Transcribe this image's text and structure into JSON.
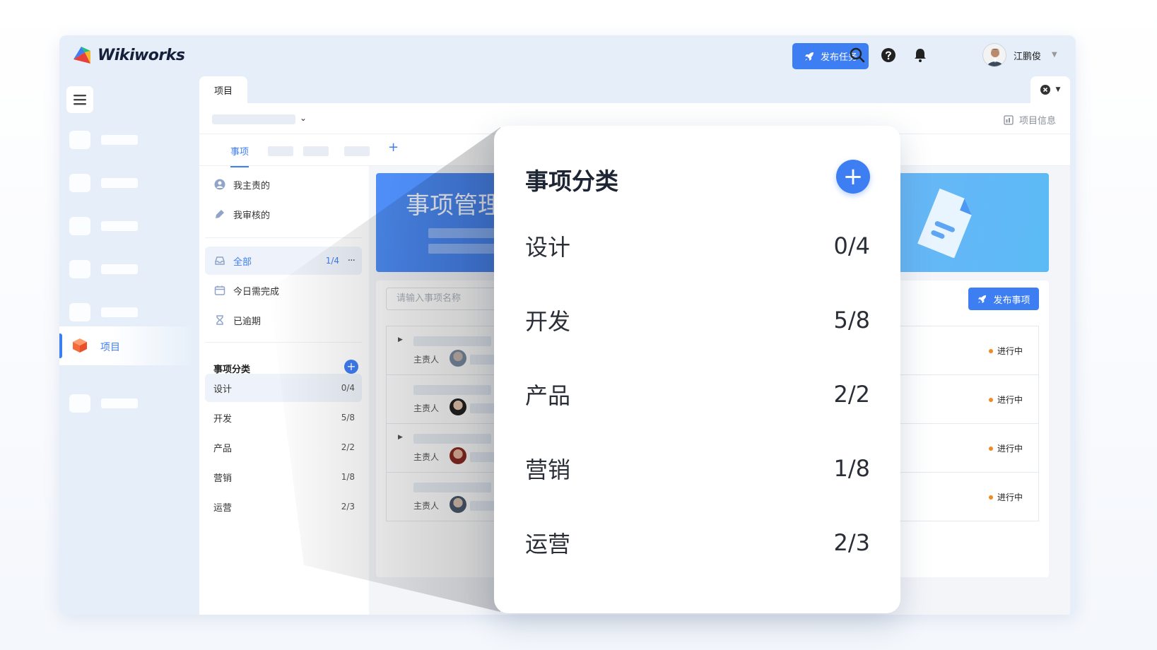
{
  "app": {
    "brand": "Wikiworks",
    "publish_task_label": "发布任务",
    "user_name": "江鹏俊"
  },
  "rail": {
    "active_label": "项目"
  },
  "tabs": {
    "project_tab": "项目"
  },
  "project": {
    "info_label": "项目信息"
  },
  "subtabs": {
    "active": "事项",
    "add": "+"
  },
  "left_nav": {
    "items": [
      {
        "label": "我主责的",
        "icon": "user-icon"
      },
      {
        "label": "我审核的",
        "icon": "pen-icon"
      }
    ],
    "filters": [
      {
        "label": "全部",
        "count": "1/4",
        "icon": "inbox-icon"
      },
      {
        "label": "今日需完成",
        "icon": "calendar-icon"
      },
      {
        "label": "已逾期",
        "icon": "hourglass-icon"
      }
    ],
    "category_title": "事项分类",
    "category_add": "+",
    "categories": [
      {
        "label": "设计",
        "count": "0/4"
      },
      {
        "label": "开发",
        "count": "5/8"
      },
      {
        "label": "产品",
        "count": "2/2"
      },
      {
        "label": "营销",
        "count": "1/8"
      },
      {
        "label": "运营",
        "count": "2/3"
      }
    ]
  },
  "content": {
    "banner_title": "事项管理",
    "search_placeholder": "请输入事项名称",
    "publish_item_label": "发布事项",
    "owner_label": "主责人",
    "rows": [
      {
        "status": "进行中",
        "expandable": true
      },
      {
        "status": "进行中",
        "expandable": false
      },
      {
        "status": "进行中",
        "expandable": true
      },
      {
        "status": "进行中",
        "expandable": false
      }
    ]
  },
  "popout": {
    "title": "事项分类",
    "add": "+",
    "categories": [
      {
        "label": "设计",
        "count": "0/4"
      },
      {
        "label": "开发",
        "count": "5/8"
      },
      {
        "label": "产品",
        "count": "2/2"
      },
      {
        "label": "营销",
        "count": "1/8"
      },
      {
        "label": "运营",
        "count": "2/3"
      }
    ]
  },
  "colors": {
    "accent": "#3e7ef3",
    "status_dot": "#f08a24",
    "app_bg": "#e6eff9"
  }
}
